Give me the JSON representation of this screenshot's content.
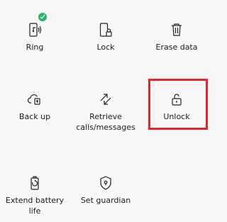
{
  "items": [
    {
      "key": "ring",
      "label": "Ring",
      "icon": "phone-ringing-icon"
    },
    {
      "key": "lock",
      "label": "Lock",
      "icon": "phone-lock-icon"
    },
    {
      "key": "erase",
      "label": "Erase data",
      "icon": "trash-icon"
    },
    {
      "key": "backup",
      "label": "Back up",
      "icon": "cloud-backup-icon"
    },
    {
      "key": "retrieve",
      "label": "Retrieve\ncalls/messages",
      "icon": "retrieve-arrows-icon"
    },
    {
      "key": "unlock",
      "label": "Unlock",
      "icon": "padlock-unlocked-icon"
    },
    {
      "key": "battery",
      "label": "Extend battery\nlife",
      "icon": "battery-icon"
    },
    {
      "key": "guardian",
      "label": "Set guardian",
      "icon": "shield-icon"
    }
  ],
  "ring_status": {
    "icon": "check-icon",
    "color": "#27b56a"
  },
  "highlight": {
    "target": "unlock",
    "color": "#e3262d"
  },
  "colors": {
    "background": "#f7f7f7",
    "text": "#202020",
    "icon": "#222222"
  }
}
